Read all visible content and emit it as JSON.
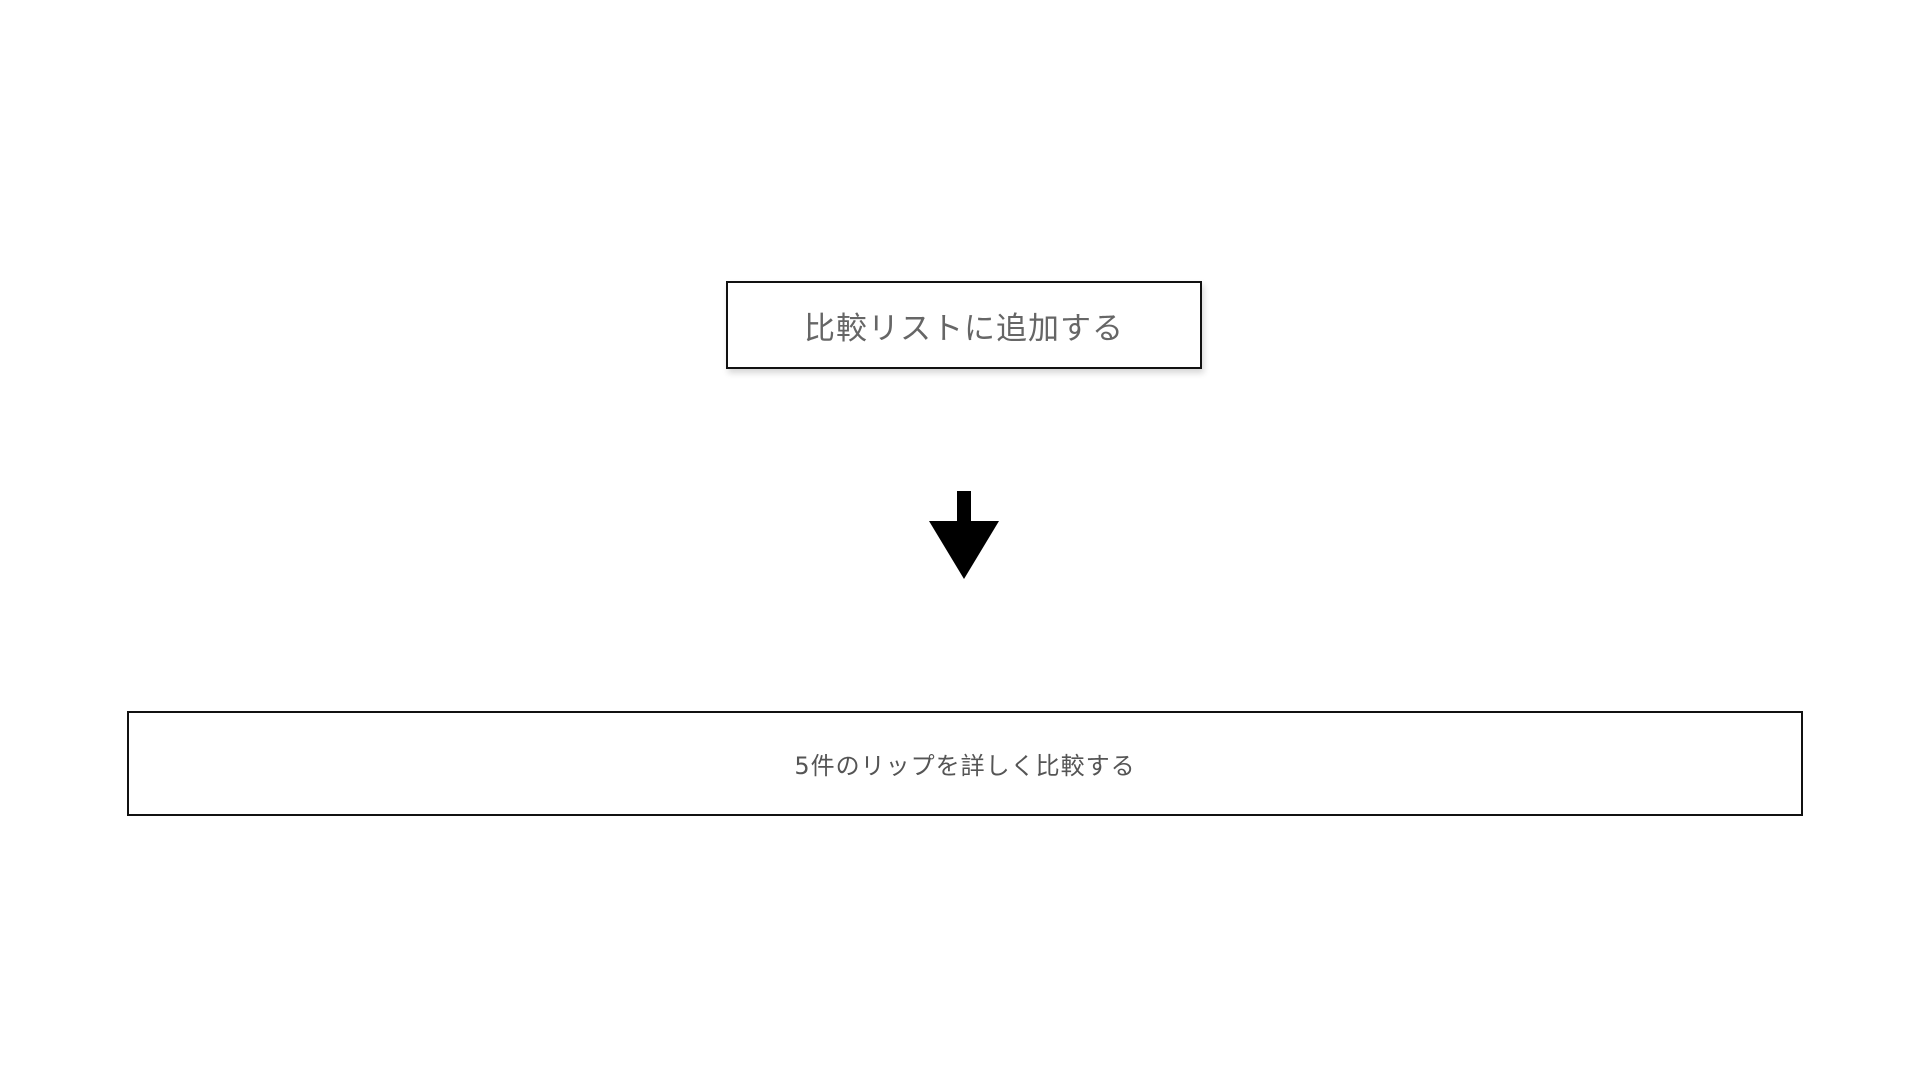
{
  "add_button": {
    "label": "比較リストに追加する"
  },
  "flow_arrow": {
    "icon": "down-arrow-icon",
    "color": "#000000"
  },
  "compare_button": {
    "label": "5件のリップを詳しく比較する"
  },
  "colors": {
    "background": "#ffffff",
    "border": "#111111",
    "text": "#666666"
  }
}
